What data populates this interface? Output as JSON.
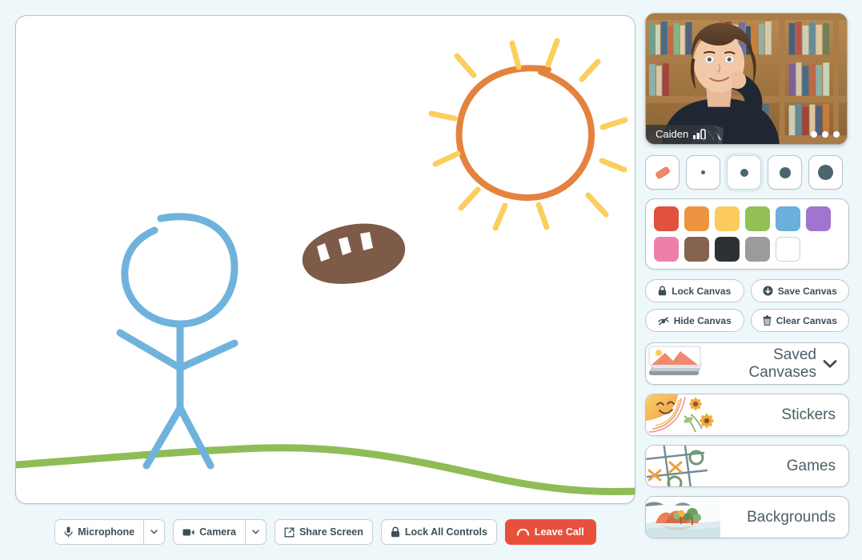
{
  "page": {
    "background_color": "#eef7fa"
  },
  "canvas": {
    "name": "drawing-canvas",
    "background_color": "#ffffff",
    "drawing_colors": {
      "figure_blue": "#6fb3dc",
      "sun_orange": "#e4823e",
      "ray_yellow": "#fbcf5f",
      "ground_green": "#8fbc56",
      "football_brown": "#7e5b48",
      "lace_white": "#ffffff"
    },
    "objects": [
      "stick-figure",
      "football-sticker",
      "sun-drawing",
      "ground-line"
    ]
  },
  "video": {
    "participant_name": "Caiden",
    "signal_icon": "signal-bars-icon",
    "page_dots": 3
  },
  "tools": {
    "selected_index": 2,
    "items": [
      {
        "name": "eraser-tool",
        "icon": "eraser-icon",
        "label": "Eraser"
      },
      {
        "name": "brush-size-1",
        "icon": "dot-icon",
        "label": "Extra small brush",
        "dot": 5
      },
      {
        "name": "brush-size-2",
        "icon": "dot-icon",
        "label": "Small brush",
        "dot": 10
      },
      {
        "name": "brush-size-3",
        "icon": "dot-icon",
        "label": "Medium brush",
        "dot": 14
      },
      {
        "name": "brush-size-4",
        "icon": "dot-icon",
        "label": "Large brush",
        "dot": 19
      }
    ]
  },
  "palette": {
    "rows": [
      [
        {
          "name": "color-red",
          "hex": "#e0523f"
        },
        {
          "name": "color-orange",
          "hex": "#ee9440"
        },
        {
          "name": "color-yellow",
          "hex": "#fbcb5d"
        },
        {
          "name": "color-green",
          "hex": "#92c055"
        },
        {
          "name": "color-blue",
          "hex": "#69b0dc"
        },
        {
          "name": "color-purple",
          "hex": "#a074cf"
        }
      ],
      [
        {
          "name": "color-pink",
          "hex": "#ee7fab"
        },
        {
          "name": "color-brown",
          "hex": "#86634e"
        },
        {
          "name": "color-black",
          "hex": "#2e3134"
        },
        {
          "name": "color-gray",
          "hex": "#9b9b9b"
        },
        {
          "name": "color-white",
          "hex": "#ffffff"
        }
      ]
    ]
  },
  "canvas_actions": [
    {
      "name": "lock-canvas-button",
      "label": "Lock Canvas",
      "icon": "lock-icon"
    },
    {
      "name": "save-canvas-button",
      "label": "Save Canvas",
      "icon": "download-circle-icon"
    },
    {
      "name": "hide-canvas-button",
      "label": "Hide Canvas",
      "icon": "eye-slash-icon"
    },
    {
      "name": "clear-canvas-button",
      "label": "Clear Canvas",
      "icon": "trash-icon"
    }
  ],
  "cards": [
    {
      "name": "saved-canvases-card",
      "label": "Saved Canvases",
      "thumb": "stacked-photos-icon",
      "caret": "chevron-down-icon"
    },
    {
      "name": "stickers-card",
      "label": "Stickers",
      "thumb": "sun-flowers-icon"
    },
    {
      "name": "games-card",
      "label": "Games",
      "thumb": "tic-tac-toe-icon"
    },
    {
      "name": "backgrounds-card",
      "label": "Backgrounds",
      "thumb": "island-landscape-icon"
    }
  ],
  "callbar": {
    "microphone": {
      "label": "Microphone",
      "icon": "microphone-icon",
      "caret": "chevron-down-icon"
    },
    "camera": {
      "label": "Camera",
      "icon": "video-camera-icon",
      "caret": "chevron-down-icon"
    },
    "share_screen": {
      "label": "Share Screen",
      "icon": "share-screen-icon"
    },
    "lock_all": {
      "label": "Lock All Controls",
      "icon": "lock-icon"
    },
    "leave": {
      "label": "Leave Call",
      "icon": "phone-hangup-icon",
      "color": "#e8503c"
    }
  }
}
